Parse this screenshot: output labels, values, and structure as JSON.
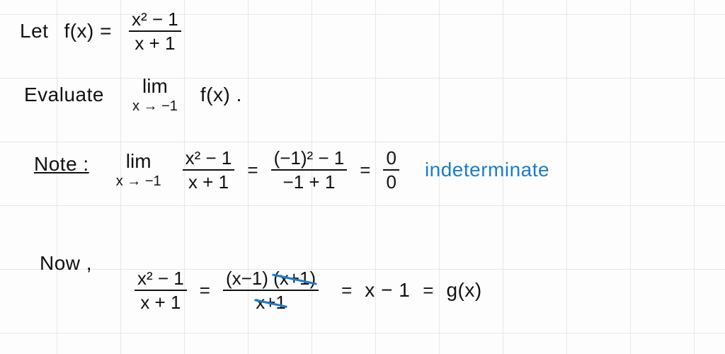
{
  "line1": {
    "let": "Let",
    "f_lhs": "f(x) =",
    "frac_num": "x² − 1",
    "frac_den": "x + 1"
  },
  "line2": {
    "evaluate": "Evaluate",
    "lim": "lim",
    "lim_sub": "x → −1",
    "fx": "f(x)  ."
  },
  "line3": {
    "note": "Note :",
    "lim": "lim",
    "lim_sub": "x → −1",
    "frac1_num": "x² − 1",
    "frac1_den": "x + 1",
    "eq1": "=",
    "frac2_num": "(−1)²  − 1",
    "frac2_den": "−1 + 1",
    "eq2": "=",
    "frac3_num": "0",
    "frac3_den": "0",
    "indet": "indeterminate"
  },
  "line4": {
    "now": "Now ,",
    "frac1_num": "x² − 1",
    "frac1_den": "x + 1",
    "eq1": "=",
    "num_left": "(x−1)",
    "num_strike": "(x+1)",
    "den_strike": "x+1",
    "eq2": "=",
    "result": "x − 1",
    "eq3": "=",
    "gx": "g(x)"
  }
}
